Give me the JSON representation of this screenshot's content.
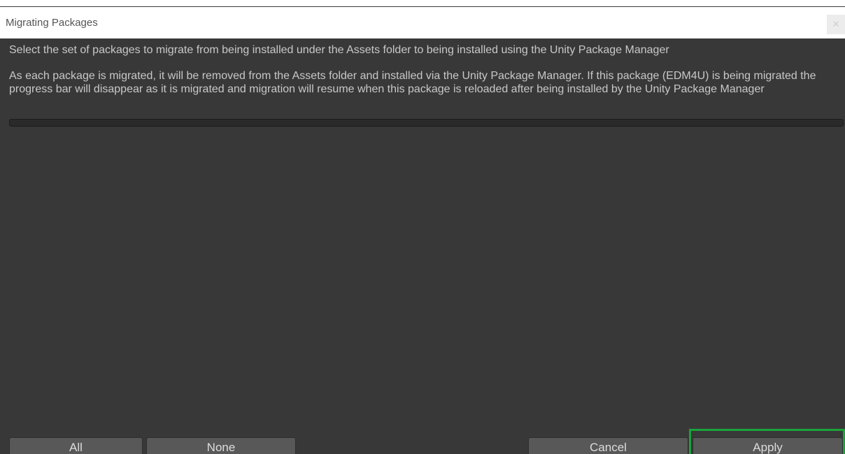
{
  "window": {
    "title": "Migrating Packages",
    "close_icon": "close-icon",
    "close_glyph": "✕"
  },
  "content": {
    "intro_text": "Select the set of packages to migrate from being installed under the Assets folder to being installed using the Unity Package Manager",
    "detail_text": "As each package is migrated, it will be removed from the Assets folder and installed via the Unity Package Manager. If this package (EDM4U) is being migrated the progress bar will disappear as it is migrated and migration will resume when this package is reloaded after being installed by the Unity Package Manager",
    "progress": 0
  },
  "buttons": {
    "all_label": "All",
    "none_label": "None",
    "cancel_label": "Cancel",
    "apply_label": "Apply"
  },
  "colors": {
    "background": "#383838",
    "text": "#c8c8c8",
    "button": "#585858",
    "highlight": "#1aa33a"
  }
}
